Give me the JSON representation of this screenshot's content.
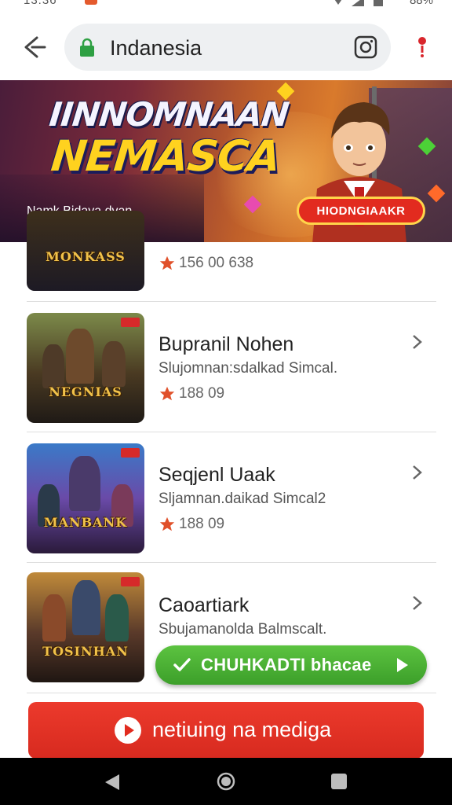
{
  "status_bar": {
    "time": "13:36",
    "battery": "88%"
  },
  "browser": {
    "url": "Indanesia",
    "icons": {
      "back": "back-arrow-icon",
      "lock": "lock-icon",
      "qr": "qr-scan-icon",
      "menu": "more-vert-icon"
    },
    "colors": {
      "lock": "#2ea043",
      "menu": "#d9262c"
    }
  },
  "banner": {
    "title_line1": "IINNOMNAAN",
    "title_line2": "NEMASCA",
    "subtitle": "Namk Bidaya dvan",
    "cta": "HIODNGIAAKR",
    "colors": {
      "title_main": "#ffd21f",
      "cta": "#e22b1f",
      "cta_border": "#ffd44a"
    }
  },
  "list": {
    "items": [
      {
        "title": "",
        "subtitle": "",
        "rating": "156 00 638",
        "thumb_logo": "MONKASS"
      },
      {
        "title": "Bupranil Nohen",
        "subtitle": "Slujomnan:sdalkad Simcal.",
        "rating": "188 09",
        "thumb_logo": "NEGNIAS"
      },
      {
        "title": "Seqjenl Uaak",
        "subtitle": "Sljamnan.daikad Simcal2",
        "rating": "188 09",
        "thumb_logo": "MANBANK"
      },
      {
        "title": "Caoartiark",
        "subtitle": "Sbujamanolda Balmscalt.",
        "rating": "",
        "thumb_logo": "TOSINHAN"
      }
    ]
  },
  "float_button": {
    "label": "CHUHKADTI bhacae",
    "color": "#3c9f2a"
  },
  "bottom_button": {
    "label": "netiuing na mediga",
    "color": "#e22b1f"
  },
  "nav_bar": {
    "icons": [
      "nav-back-icon",
      "nav-home-icon",
      "nav-recents-icon"
    ]
  }
}
